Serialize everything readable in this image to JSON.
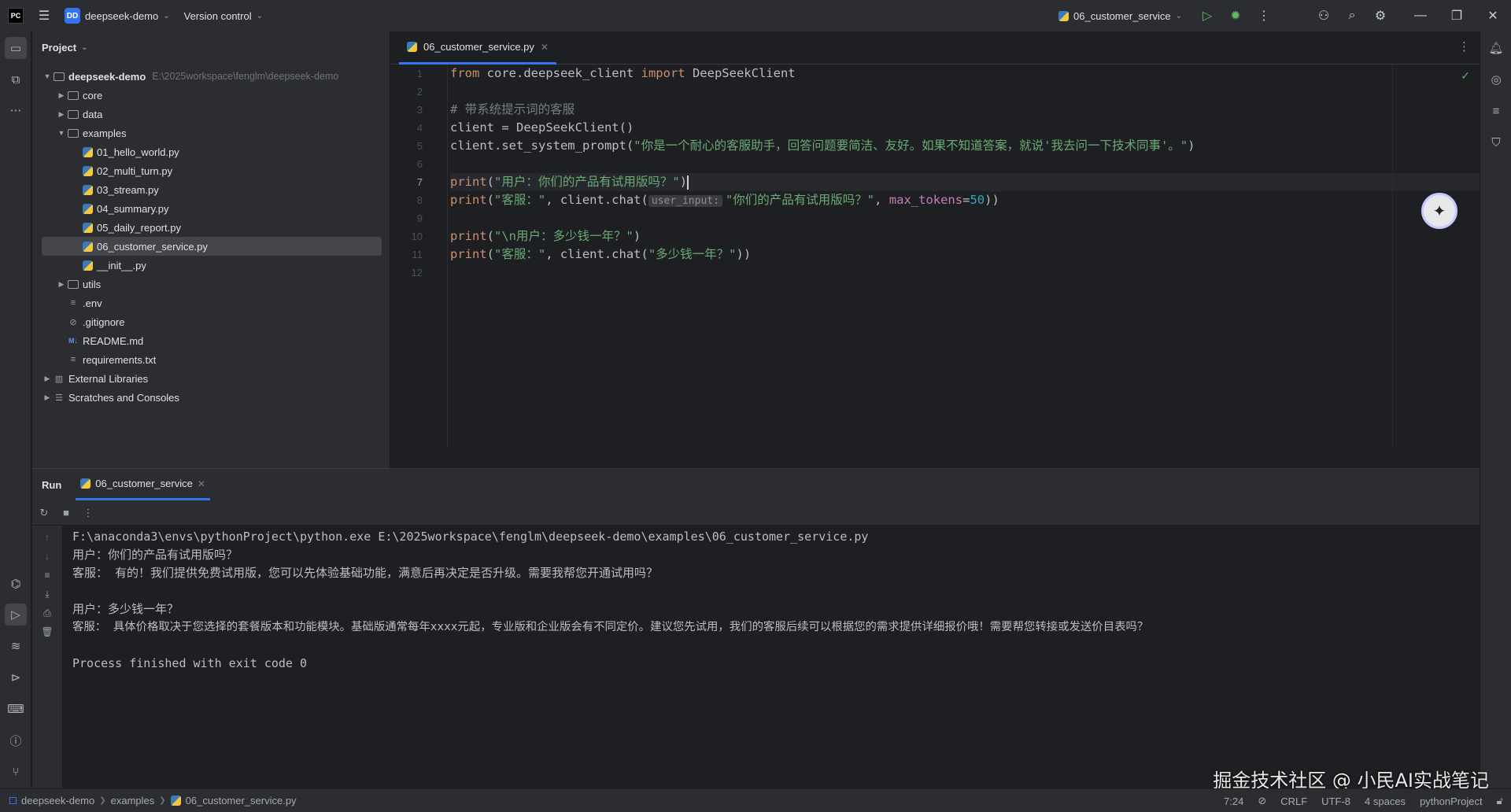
{
  "titlebar": {
    "logo": "PC",
    "project_badge": "DD",
    "project_name": "deepseek-demo",
    "vcs": "Version control",
    "run_config": "06_customer_service"
  },
  "project_panel": {
    "title": "Project",
    "root_name": "deepseek-demo",
    "root_path": "E:\\2025workspace\\fenglm\\deepseek-demo",
    "items": [
      {
        "label": "core",
        "type": "folder"
      },
      {
        "label": "data",
        "type": "folder"
      },
      {
        "label": "examples",
        "type": "folder"
      },
      {
        "label": "01_hello_world.py",
        "type": "py"
      },
      {
        "label": "02_multi_turn.py",
        "type": "py"
      },
      {
        "label": "03_stream.py",
        "type": "py"
      },
      {
        "label": "04_summary.py",
        "type": "py"
      },
      {
        "label": "05_daily_report.py",
        "type": "py"
      },
      {
        "label": "06_customer_service.py",
        "type": "py"
      },
      {
        "label": "__init__.py",
        "type": "py"
      },
      {
        "label": "utils",
        "type": "folder"
      },
      {
        "label": ".env",
        "type": "text"
      },
      {
        "label": ".gitignore",
        "type": "ignore"
      },
      {
        "label": "README.md",
        "type": "md"
      },
      {
        "label": "requirements.txt",
        "type": "text"
      },
      {
        "label": "External Libraries",
        "type": "lib"
      },
      {
        "label": "Scratches and Consoles",
        "type": "scratch"
      }
    ]
  },
  "editor": {
    "tab_label": "06_customer_service.py",
    "line_numbers": [
      "1",
      "2",
      "3",
      "4",
      "5",
      "6",
      "7",
      "8",
      "9",
      "10",
      "11",
      "12"
    ],
    "code": {
      "l1_from": "from",
      "l1_mod": " core.deepseek_client ",
      "l1_import": "import",
      "l1_name": " DeepSeekClient",
      "l3": "# 带系统提示词的客服",
      "l4": "client = DeepSeekClient()",
      "l5_a": "client.set_system_prompt(",
      "l5_str": "\"你是一个耐心的客服助手，回答问题要简洁、友好。如果不知道答案，就说'我去问一下技术同事'。\"",
      "l5_b": ")",
      "l7_print": "print",
      "l7_a": "(",
      "l7_str": "\"用户：你们的产品有试用版吗？\"",
      "l7_b": ")",
      "l8_print": "print",
      "l8_a": "(",
      "l8_str1": "\"客服：\"",
      "l8_b": ", client.chat(",
      "l8_hint": "user_input:",
      "l8_str2": "\"你们的产品有试用版吗？\"",
      "l8_c": ", ",
      "l8_param": "max_tokens",
      "l8_eq": "=",
      "l8_num": "50",
      "l8_d": "))",
      "l10_print": "print",
      "l10_a": "(",
      "l10_str": "\"\\n用户：多少钱一年？\"",
      "l10_b": ")",
      "l11_print": "print",
      "l11_a": "(",
      "l11_str1": "\"客服：\"",
      "l11_b": ", client.chat(",
      "l11_str2": "\"多少钱一年？\"",
      "l11_c": "))"
    }
  },
  "run_panel": {
    "title": "Run",
    "tab_label": "06_customer_service",
    "console": [
      "F:\\anaconda3\\envs\\pythonProject\\python.exe E:\\2025workspace\\fenglm\\deepseek-demo\\examples\\06_customer_service.py",
      "用户：你们的产品有试用版吗？",
      "客服： 有的！我们提供免费试用版，您可以先体验基础功能，满意后再决定是否升级。需要我帮您开通试用吗？",
      "",
      "用户：多少钱一年？",
      "客服： 具体价格取决于您选择的套餐版本和功能模块。基础版通常每年xxxx元起，专业版和企业版会有不同定价。建议您先试用，我们的客服后续可以根据您的需求提供详细报价哦！需要帮您转接或发送价目表吗？",
      "",
      "Process finished with exit code 0"
    ]
  },
  "statusbar": {
    "crumbs": [
      "deepseek-demo",
      "examples",
      "06_customer_service.py"
    ],
    "position": "7:24",
    "line_sep": "CRLF",
    "encoding": "UTF-8",
    "indent": "4 spaces",
    "interpreter": "pythonProject"
  },
  "watermark": "掘金技术社区 @ 小民AI实战笔记",
  "colors": {
    "accent": "#3574f0",
    "keyword": "#cf8e6d",
    "string": "#6aab73",
    "number": "#2aacb8",
    "param": "#c77dbb",
    "background": "#1e1f22",
    "panel": "#2b2d30"
  }
}
